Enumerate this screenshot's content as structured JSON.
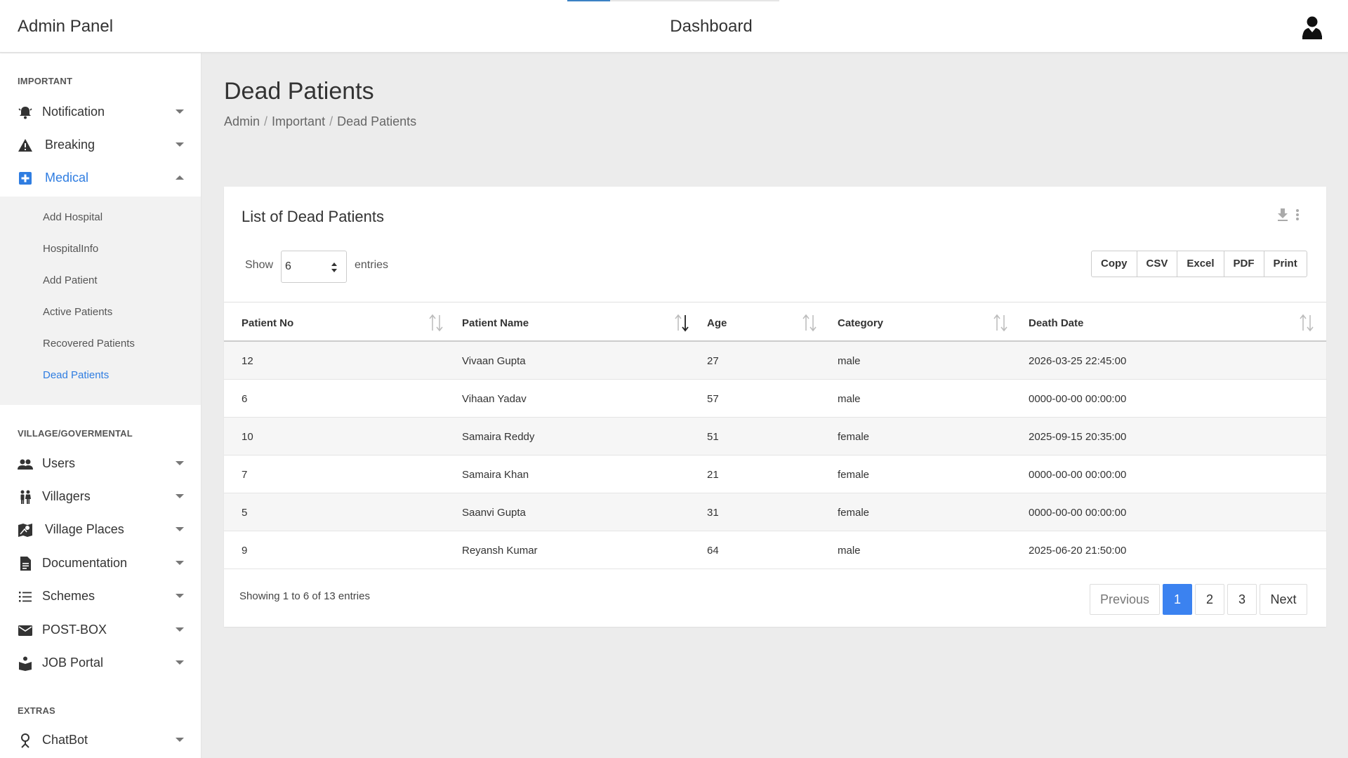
{
  "header": {
    "brand": "Admin Panel",
    "title": "Dashboard"
  },
  "sidebar": {
    "sections": {
      "important": "IMPORTANT",
      "village": "VILLAGE/GOVERMENTAL",
      "extras": "EXTRAS"
    },
    "items": {
      "notification": "Notification",
      "breaking": "Breaking",
      "medical": "Medical",
      "users": "Users",
      "villagers": "Villagers",
      "village_places": "Village Places",
      "documentation": "Documentation",
      "schemes": "Schemes",
      "post_box": "POST-BOX",
      "job_portal": "JOB Portal",
      "chatbot": "ChatBot"
    },
    "medical_submenu": {
      "add_hospital": "Add Hospital",
      "hospital_info": "HospitalInfo",
      "add_patient": "Add Patient",
      "active_patients": "Active Patients",
      "recovered_patients": "Recovered Patients",
      "dead_patients": "Dead Patients"
    },
    "accent_color": "#2f7de1"
  },
  "page": {
    "title": "Dead Patients",
    "breadcrumb": [
      "Admin",
      "Important",
      "Dead Patients"
    ]
  },
  "card": {
    "title": "List of Dead Patients",
    "show_label": "Show",
    "show_value": "6",
    "entries_label": "entries",
    "export_buttons": [
      "Copy",
      "CSV",
      "Excel",
      "PDF",
      "Print"
    ],
    "columns": [
      "Patient No",
      "Patient Name",
      "Age",
      "Category",
      "Death Date"
    ],
    "rows": [
      [
        "12",
        "Vivaan Gupta",
        "27",
        "male",
        "2026-03-25 22:45:00"
      ],
      [
        "6",
        "Vihaan Yadav",
        "57",
        "male",
        "0000-00-00 00:00:00"
      ],
      [
        "10",
        "Samaira Reddy",
        "51",
        "female",
        "2025-09-15 20:35:00"
      ],
      [
        "7",
        "Samaira Khan",
        "21",
        "female",
        "0000-00-00 00:00:00"
      ],
      [
        "5",
        "Saanvi Gupta",
        "31",
        "female",
        "0000-00-00 00:00:00"
      ],
      [
        "9",
        "Reyansh Kumar",
        "64",
        "male",
        "2025-06-20 21:50:00"
      ]
    ],
    "info": "Showing 1 to 6 of 13 entries",
    "pagination": {
      "previous": "Previous",
      "pages": [
        "1",
        "2",
        "3"
      ],
      "current": "1",
      "next": "Next"
    },
    "pagination_accent": "#3b82f0"
  }
}
